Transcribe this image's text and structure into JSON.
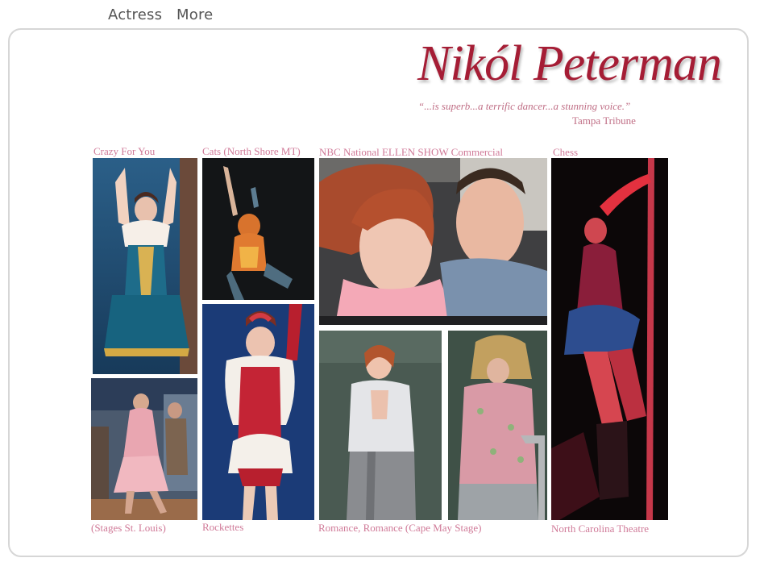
{
  "nav": {
    "items": [
      {
        "label": "Actress"
      },
      {
        "label": "More"
      }
    ]
  },
  "header": {
    "name": "Nikól Peterman",
    "quote": "“...is superb...a terrific dancer...a stunning voice.”",
    "quote_source": "Tampa Tribune"
  },
  "gallery": {
    "captions": {
      "crazy_for_you": "Crazy For You",
      "cats": "Cats (North Shore MT)",
      "nbc": "NBC National ELLEN SHOW Commercial",
      "chess": "Chess",
      "stages": "(Stages St. Louis)",
      "rockettes": "Rockettes",
      "romance": "Romance, Romance (Cape May Stage)",
      "nc_theatre": "North Carolina Theatre"
    }
  },
  "colors": {
    "name": "#a51d35",
    "caption": "#d07a98",
    "nav": "#555555"
  }
}
